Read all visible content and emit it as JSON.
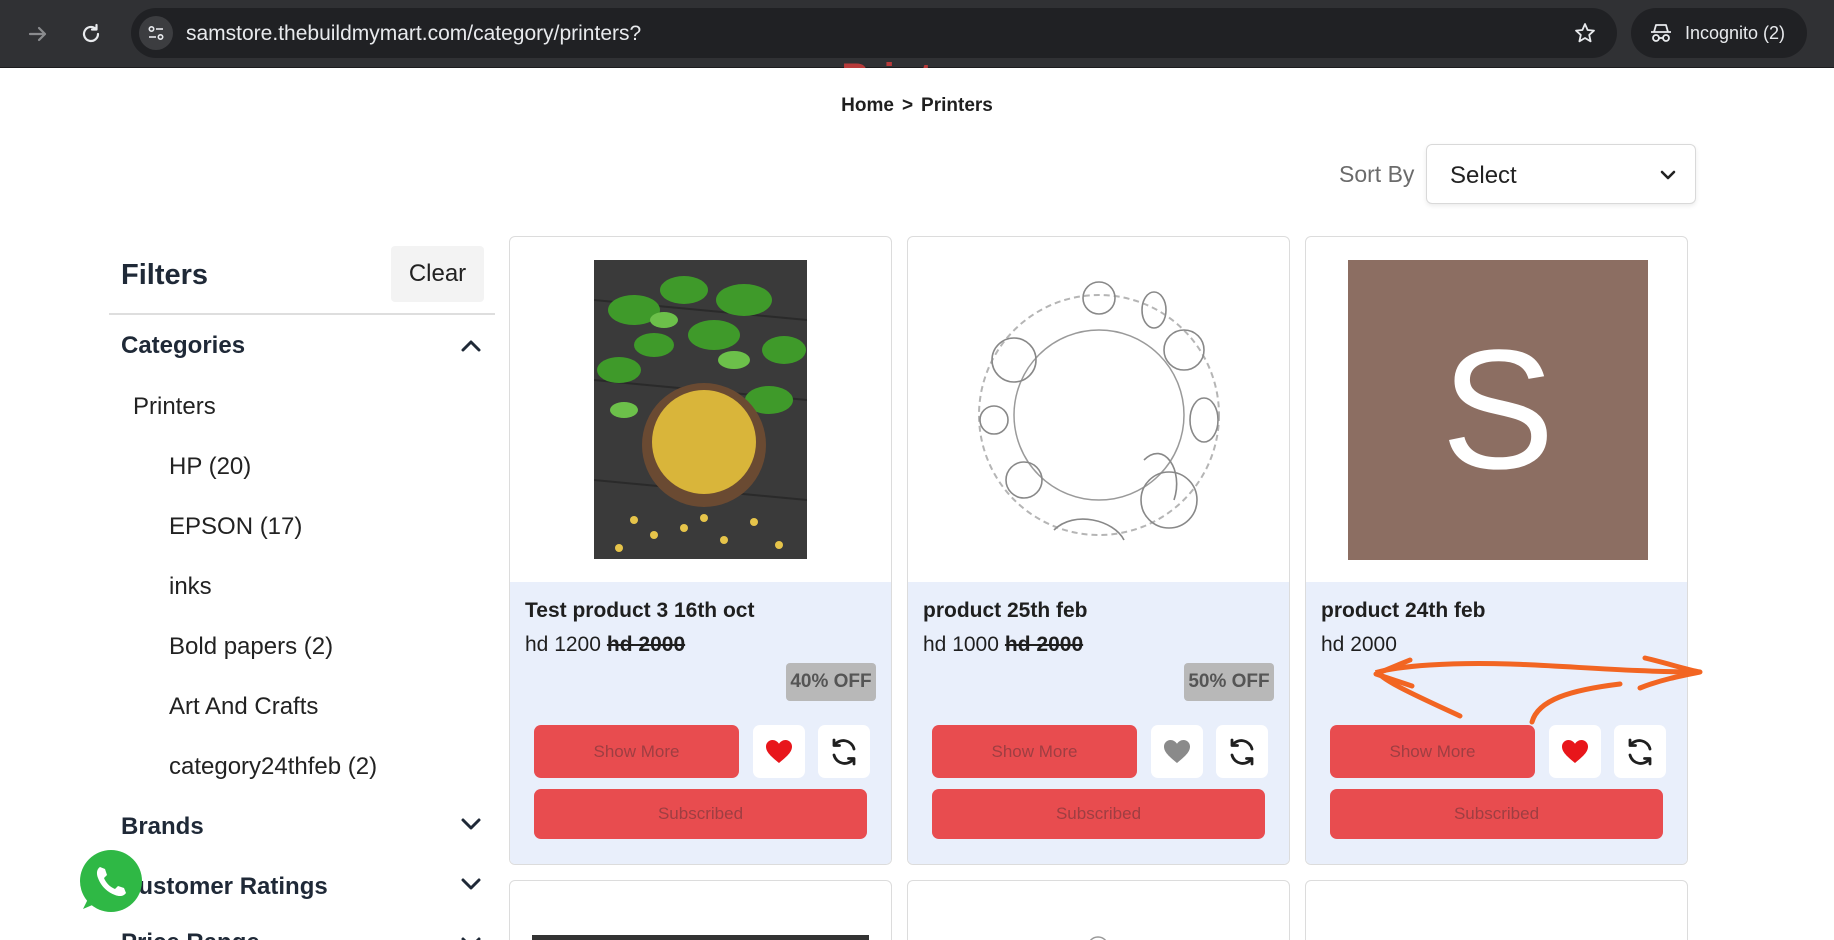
{
  "browser": {
    "url": "samstore.thebuildmymart.com/category/printers?",
    "profile_label": "Incognito (2)",
    "icons": [
      "forward-icon",
      "reload-icon",
      "site-info-icon",
      "bookmark-star-icon",
      "incognito-icon"
    ]
  },
  "page": {
    "title_partial": "Printers",
    "breadcrumb": {
      "home": "Home",
      "separator": ">",
      "current": "Printers"
    },
    "sort": {
      "label": "Sort By",
      "value": "Select"
    }
  },
  "filters": {
    "title": "Filters",
    "clear_label": "Clear",
    "sections": {
      "categories": "Categories",
      "brands": "Brands",
      "ratings": "Customer Ratings",
      "price_partial": "Price Range"
    },
    "category_parent": "Printers",
    "category_items": [
      "HP (20)",
      "EPSON (17)",
      "inks",
      "Bold papers (2)",
      "Art And Crafts",
      "category24thfeb (2)"
    ]
  },
  "products": [
    {
      "name": "Test product 3 16th oct",
      "price": "hd 1200",
      "old_price": "hd 2000",
      "discount": "40% OFF",
      "show_more": "Show More",
      "subscribed": "Subscribed",
      "wishlisted": true
    },
    {
      "name": "product 25th feb",
      "price": "hd 1000",
      "old_price": "hd 2000",
      "discount": "50% OFF",
      "show_more": "Show More",
      "subscribed": "Subscribed",
      "wishlisted": false
    },
    {
      "name": "product 24th feb",
      "price": "hd 2000",
      "old_price": "",
      "discount": "",
      "image_letter": "S",
      "show_more": "Show More",
      "subscribed": "Subscribed",
      "wishlisted": true
    }
  ],
  "colors": {
    "accent_red": "#e84c4f",
    "heart_active": "#e8161b",
    "heart_inactive": "#8a8a8a",
    "card_info_bg": "#e9effb",
    "placeholder_bg": "#8c6e62",
    "annotation_orange": "#f26522"
  }
}
